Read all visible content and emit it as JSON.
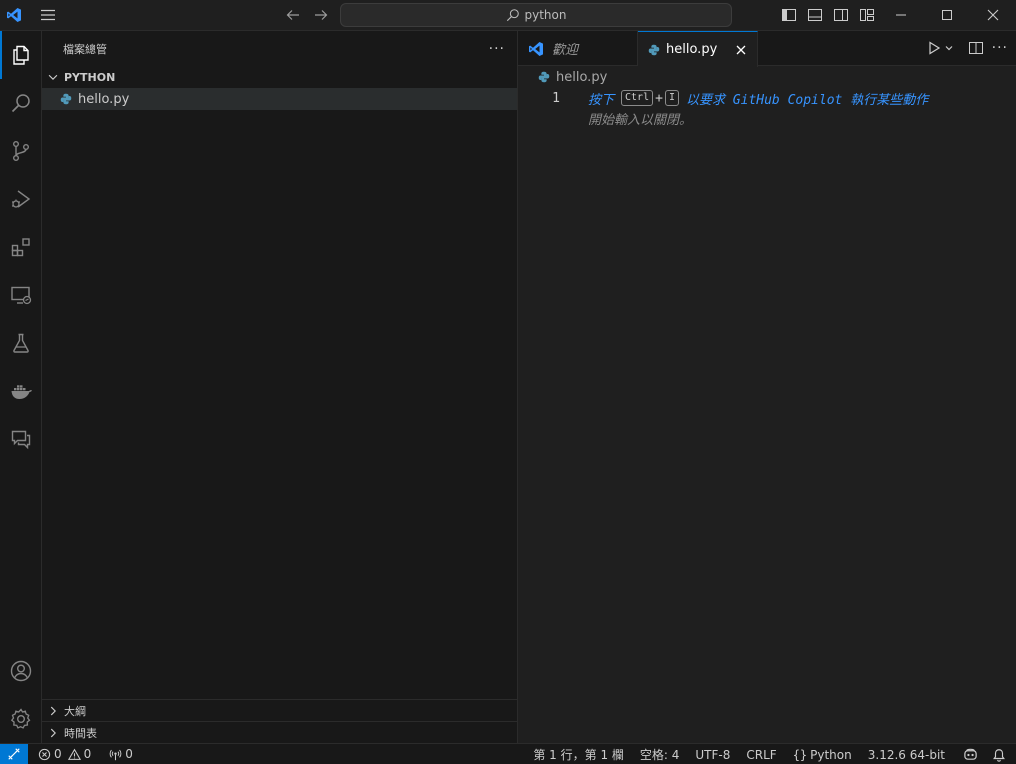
{
  "titlebar": {
    "search_text": "python"
  },
  "sidebar": {
    "title": "檔案總管",
    "folder_name": "PYTHON",
    "files": [
      {
        "name": "hello.py"
      }
    ],
    "outline_label": "大綱",
    "timeline_label": "時間表"
  },
  "editor": {
    "tabs": [
      {
        "label": "歡迎",
        "active": false
      },
      {
        "label": "hello.py",
        "active": true
      }
    ],
    "breadcrumb": "hello.py",
    "line_number": "1",
    "hint_prefix": "按下",
    "hint_key1": "Ctrl",
    "hint_plus": "+",
    "hint_key2": "I",
    "hint_suffix": "以要求 GitHub Copilot 執行某些動作",
    "hint_line2": "開始輸入以關閉。"
  },
  "statusbar": {
    "errors": "0",
    "warnings": "0",
    "ports": "0",
    "position": "第 1 行，第 1 欄",
    "spaces": "空格: 4",
    "encoding": "UTF-8",
    "eol": "CRLF",
    "language": "Python",
    "interpreter": "3.12.6 64-bit"
  },
  "colors": {
    "accent": "#0078d4",
    "hint_blue": "#3794ff",
    "python_icon": "#519aba"
  }
}
